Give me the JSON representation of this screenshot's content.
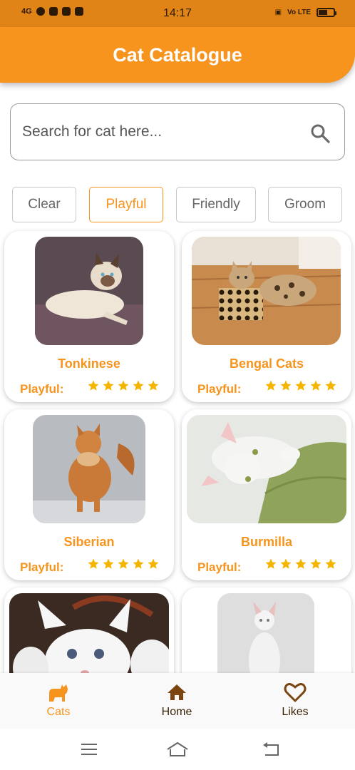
{
  "status_bar": {
    "time": "14:17",
    "left_indicators": "4G",
    "right_indicators": "Vo LTE",
    "battery_level_percent": 60
  },
  "header": {
    "title": "Cat Catalogue"
  },
  "search": {
    "placeholder": "Search for cat here...",
    "value": ""
  },
  "filters": [
    {
      "label": "Clear",
      "active": false
    },
    {
      "label": "Playful",
      "active": true
    },
    {
      "label": "Friendly",
      "active": false
    },
    {
      "label": "Groom",
      "active": false
    }
  ],
  "cats": [
    {
      "name": "Tonkinese",
      "trait": "Playful:",
      "rating": 5
    },
    {
      "name": "Bengal Cats",
      "trait": "Playful:",
      "rating": 5
    },
    {
      "name": "Siberian",
      "trait": "Playful:",
      "rating": 5
    },
    {
      "name": "Burmilla",
      "trait": "Playful:",
      "rating": 5
    }
  ],
  "bottom_nav": [
    {
      "label": "Cats",
      "icon": "cat-icon",
      "active": true
    },
    {
      "label": "Home",
      "icon": "home-icon",
      "active": false
    },
    {
      "label": "Likes",
      "icon": "heart-icon",
      "active": false
    }
  ],
  "colors": {
    "accent": "#f7941d",
    "status_bar": "#e18417",
    "star": "#f5b400",
    "nav_dark": "#3b2407"
  },
  "system_nav": {
    "icons": [
      "menu-icon",
      "home-outline-icon",
      "back-icon"
    ]
  }
}
